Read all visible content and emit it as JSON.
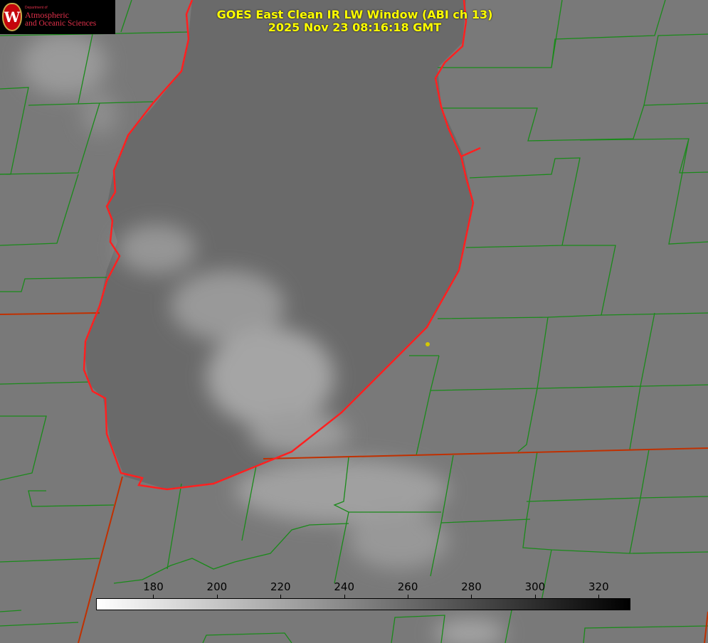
{
  "title": {
    "line1": "GOES East Clean IR LW Window (ABI ch 13)",
    "line2": "2025 Nov 23 08:16:18 GMT"
  },
  "logo": {
    "dept": "Department of",
    "line1": "Atmospheric",
    "line2": "and Oceanic Sciences",
    "mark": "W"
  },
  "colorbar": {
    "min": 162,
    "max": 330,
    "ticks": [
      {
        "value": 180,
        "label": "180"
      },
      {
        "value": 200,
        "label": "200"
      },
      {
        "value": 220,
        "label": "220"
      },
      {
        "value": 240,
        "label": "240"
      },
      {
        "value": 260,
        "label": "260"
      },
      {
        "value": 280,
        "label": "280"
      },
      {
        "value": 300,
        "label": "300"
      },
      {
        "value": 320,
        "label": "320"
      }
    ],
    "colors": {
      "low": "#ffffff",
      "high": "#000000"
    }
  },
  "colors": {
    "coast": "#ff2020",
    "counties": "#1a8a1a",
    "title": "#ffff00",
    "marker": "#d4c800"
  }
}
